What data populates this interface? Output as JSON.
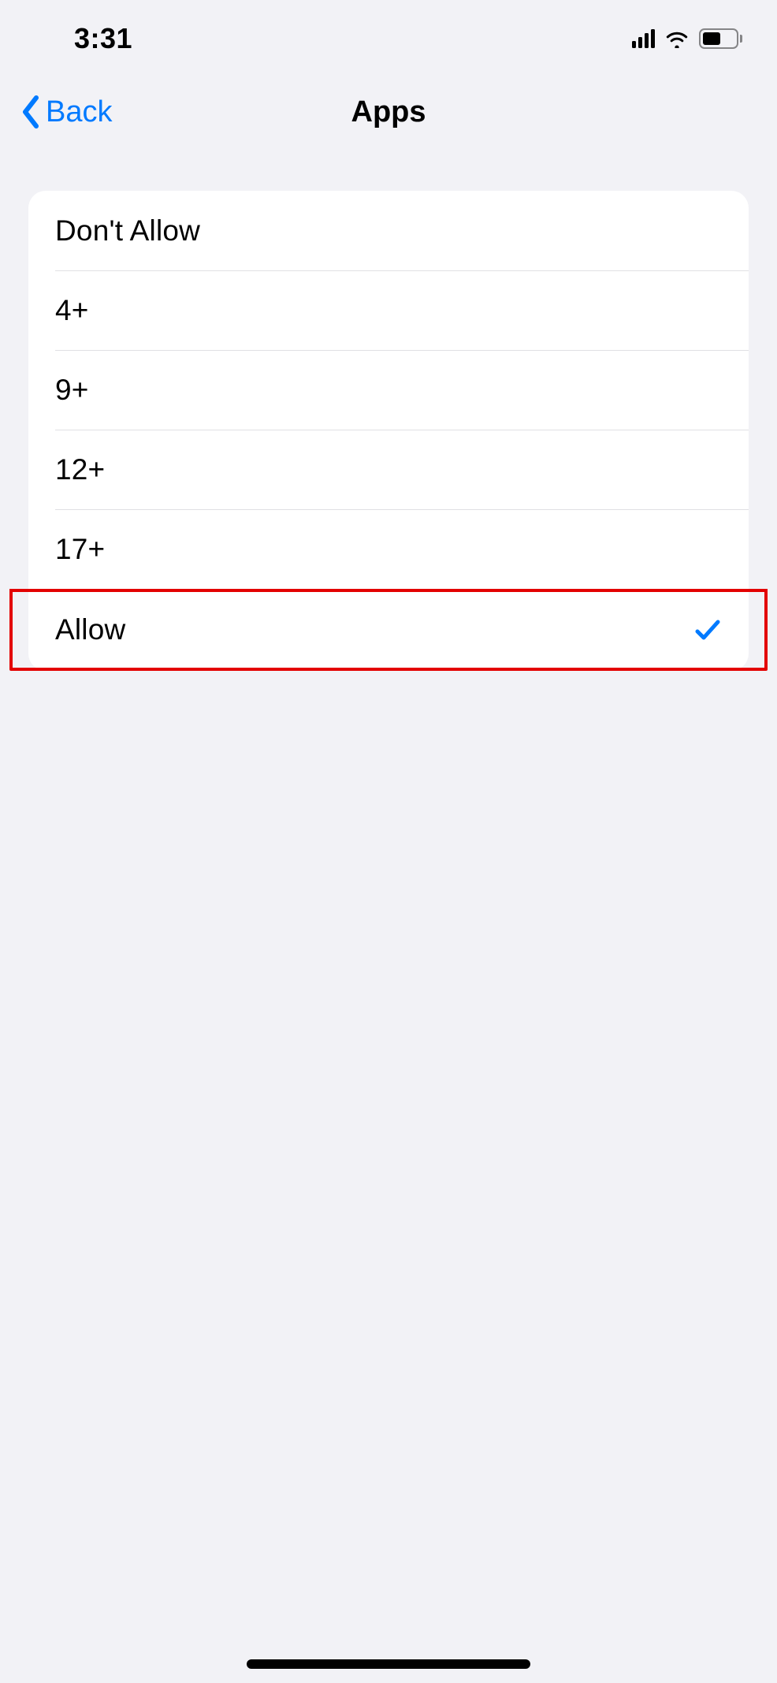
{
  "status": {
    "time": "3:31"
  },
  "nav": {
    "back_label": "Back",
    "title": "Apps"
  },
  "options": {
    "dont_allow": "Don't Allow",
    "age4": "4+",
    "age9": "9+",
    "age12": "12+",
    "age17": "17+",
    "allow": "Allow"
  },
  "selected": "allow"
}
